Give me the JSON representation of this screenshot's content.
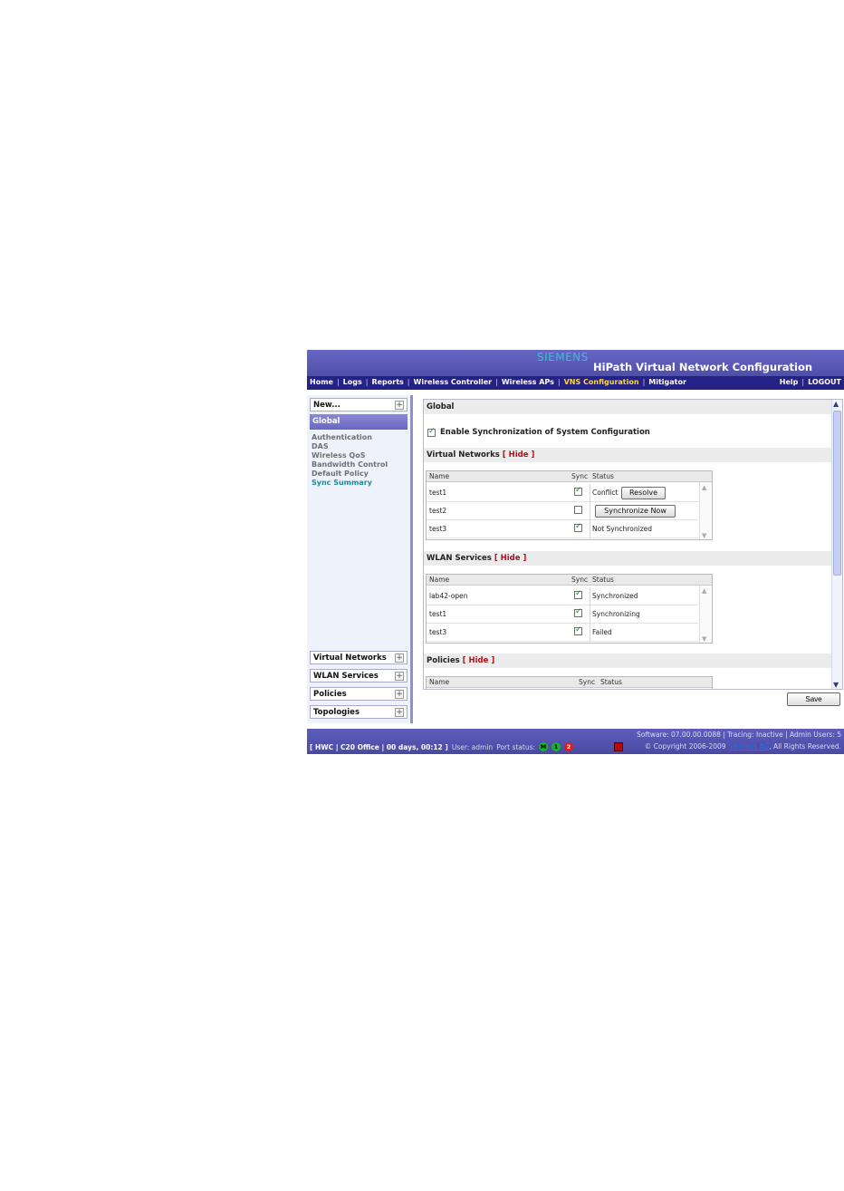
{
  "header": {
    "brand": "SIEMENS",
    "title": "HiPath Virtual Network Configuration"
  },
  "nav": {
    "items": [
      "Home",
      "Logs",
      "Reports",
      "Wireless Controller",
      "Wireless APs",
      "VNS Configuration",
      "Mitigator"
    ],
    "active": "VNS Configuration",
    "right": [
      "Help",
      "LOGOUT"
    ]
  },
  "sidebar": {
    "new_label": "New...",
    "active_label": "Global",
    "links": [
      "Authentication",
      "DAS",
      "Wireless QoS",
      "Bandwidth Control",
      "Default Policy",
      "Sync Summary"
    ],
    "current_link": "Sync Summary",
    "sections": [
      "Virtual Networks",
      "WLAN Services",
      "Policies",
      "Topologies"
    ]
  },
  "content": {
    "title": "Global",
    "enable_sync_label": "Enable Synchronization of System Configuration",
    "enable_sync_checked": true,
    "hide_label": "[ Hide ]",
    "columns": {
      "name": "Name",
      "sync": "Sync",
      "status": "Status"
    },
    "virtual_networks": {
      "title": "Virtual Networks",
      "rows": [
        {
          "name": "test1",
          "sync": true,
          "status": "Conflict",
          "button": "Resolve"
        },
        {
          "name": "test2",
          "sync": false,
          "status": "",
          "button": "Synchronize Now"
        },
        {
          "name": "test3",
          "sync": true,
          "status": "Not Synchronized",
          "button": ""
        }
      ]
    },
    "wlan_services": {
      "title": "WLAN Services",
      "rows": [
        {
          "name": "lab42-open",
          "sync": true,
          "status": "Synchronized"
        },
        {
          "name": "test1",
          "sync": true,
          "status": "Synchronizing"
        },
        {
          "name": "test3",
          "sync": true,
          "status": "Failed"
        }
      ]
    },
    "policies": {
      "title": "Policies"
    },
    "save_label": "Save"
  },
  "footer": {
    "location": "[ HWC | C20 Office | 00 days, 00:12 ]",
    "user": "User: admin",
    "port_status_label": "Port status:",
    "ports": [
      {
        "label": "M",
        "color": "#14b629"
      },
      {
        "label": "1",
        "color": "#14b629"
      },
      {
        "label": "2",
        "color": "#e11c18"
      }
    ],
    "software": "Software: 07.00.00.0088 | Tracing: Inactive | Admin Users: 5",
    "copyright_prefix": "© Copyright 2006-2009",
    "copyright_link": "Siemens AG",
    "copyright_suffix": ", All Rights Reserved."
  }
}
